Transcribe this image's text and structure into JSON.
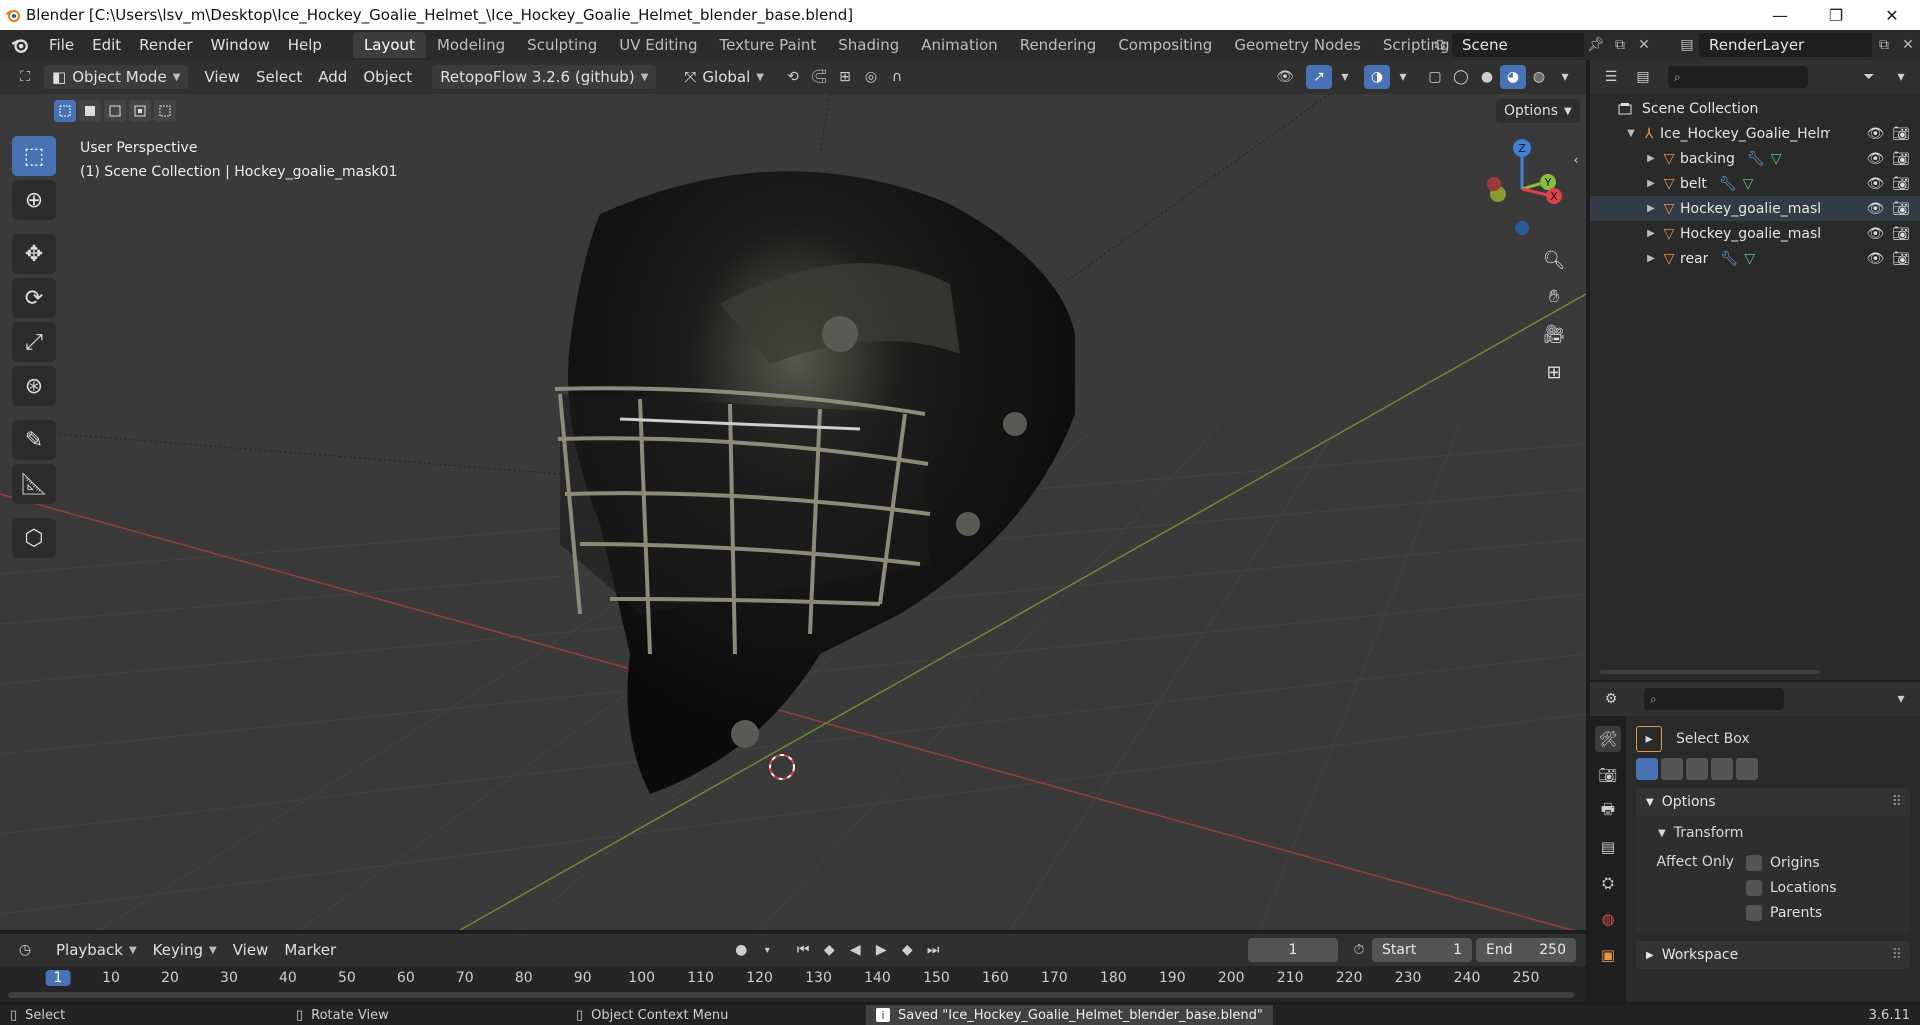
{
  "titlebar": {
    "title": "Blender [C:\\Users\\lsv_m\\Desktop\\Ice_Hockey_Goalie_Helmet_\\Ice_Hockey_Goalie_Helmet_blender_base.blend]"
  },
  "menu": [
    "File",
    "Edit",
    "Render",
    "Window",
    "Help"
  ],
  "workspaces": [
    "Layout",
    "Modeling",
    "Sculpting",
    "UV Editing",
    "Texture Paint",
    "Shading",
    "Animation",
    "Rendering",
    "Compositing",
    "Geometry Nodes",
    "Scripting"
  ],
  "scene": {
    "name": "Scene",
    "render_layer": "RenderLayer"
  },
  "viewport_header": {
    "mode": "Object Mode",
    "menus": [
      "View",
      "Select",
      "Add",
      "Object"
    ],
    "addon": "RetopoFlow 3.2.6 (github)",
    "orientation": "Global",
    "options": "Options"
  },
  "viewport": {
    "perspective": "User Perspective",
    "collection_info": "(1) Scene Collection | Hockey_goalie_mask01"
  },
  "gizmo": {
    "z": "Z",
    "y": "Y",
    "x": "X"
  },
  "outliner": {
    "root": "Scene Collection",
    "collection": "Ice_Hockey_Goalie_Helme",
    "items": [
      {
        "label": "backing"
      },
      {
        "label": "belt"
      },
      {
        "label": "Hockey_goalie_mask0"
      },
      {
        "label": "Hockey_goalie_mask0"
      },
      {
        "label": "rear"
      }
    ]
  },
  "properties": {
    "tool": "Select Box",
    "options": "Options",
    "transform": "Transform",
    "affect_only": "Affect Only",
    "checks": [
      "Origins",
      "Locations",
      "Parents"
    ],
    "workspace": "Workspace"
  },
  "timeline": {
    "menus": [
      "Playback",
      "Keying",
      "View",
      "Marker"
    ],
    "current_frame": "1",
    "start_label": "Start",
    "start": "1",
    "end_label": "End",
    "end": "250",
    "ticks": [
      "1",
      "10",
      "20",
      "30",
      "40",
      "50",
      "60",
      "70",
      "80",
      "90",
      "100",
      "110",
      "120",
      "130",
      "140",
      "150",
      "160",
      "170",
      "180",
      "190",
      "200",
      "210",
      "220",
      "230",
      "240",
      "250"
    ]
  },
  "statusbar": {
    "select": "Select",
    "rotate": "Rotate View",
    "context": "Object Context Menu",
    "saved": "Saved \"Ice_Hockey_Goalie_Helmet_blender_base.blend\"",
    "version": "3.6.11"
  },
  "colors": {
    "accent": "#4772b3",
    "x_axis": "#e0404a",
    "y_axis": "#8cbd3a",
    "z_axis": "#3f82d8",
    "object_orange": "#e8954a"
  }
}
